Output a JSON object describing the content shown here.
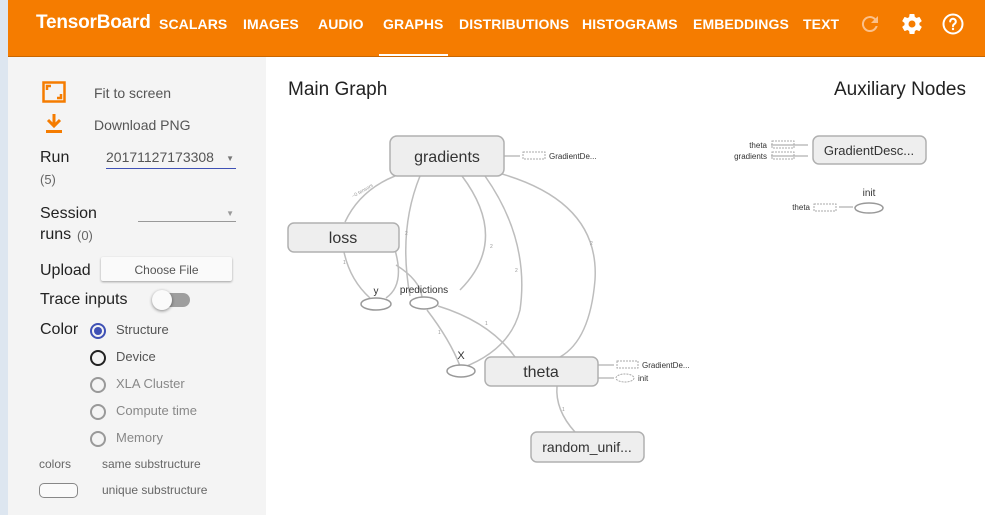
{
  "header": {
    "logo": "TensorBoard",
    "tabs": [
      {
        "label": "SCALARS"
      },
      {
        "label": "IMAGES"
      },
      {
        "label": "AUDIO"
      },
      {
        "label": "GRAPHS",
        "active": true
      },
      {
        "label": "DISTRIBUTIONS"
      },
      {
        "label": "HISTOGRAMS"
      },
      {
        "label": "EMBEDDINGS"
      },
      {
        "label": "TEXT"
      }
    ],
    "icons": [
      "refresh-icon",
      "settings-gear-icon",
      "help-icon"
    ]
  },
  "sidebar": {
    "fit_label": "Fit to screen",
    "download_label": "Download PNG",
    "run_label": "Run",
    "run_count": "(5)",
    "run_value": "20171127173308",
    "session_label_1": "Session",
    "session_label_2": "runs",
    "session_count": "(0)",
    "upload_label": "Upload",
    "choose_file": "Choose File",
    "trace_label": "Trace inputs",
    "color_label": "Color",
    "color_options": [
      {
        "label": "Structure",
        "selected": true
      },
      {
        "label": "Device"
      },
      {
        "label": "XLA Cluster"
      },
      {
        "label": "Compute time"
      },
      {
        "label": "Memory"
      }
    ],
    "legend_colors_label": "colors",
    "legend_same": "same substructure",
    "legend_unique": "unique substructure"
  },
  "main_graph": {
    "title": "Main Graph",
    "nodes": {
      "gradients": "gradients",
      "loss": "loss",
      "theta": "theta",
      "random": "random_unif...",
      "y": "y",
      "predictions": "predictions",
      "x": "X"
    },
    "gradients_ref": "GradientDe...",
    "theta_refs": [
      "GradientDe...",
      "init"
    ]
  },
  "aux_graph": {
    "title": "Auxiliary Nodes",
    "gradient_node": "GradientDesc...",
    "theta_in": "theta",
    "gradients_in": "gradients",
    "init_label": "init",
    "theta_in2": "theta"
  },
  "colors": {
    "header": "#f57c00",
    "accent": "#3f51b5",
    "node_fill": "#eeeeee",
    "node_stroke": "#b0b0b0"
  }
}
